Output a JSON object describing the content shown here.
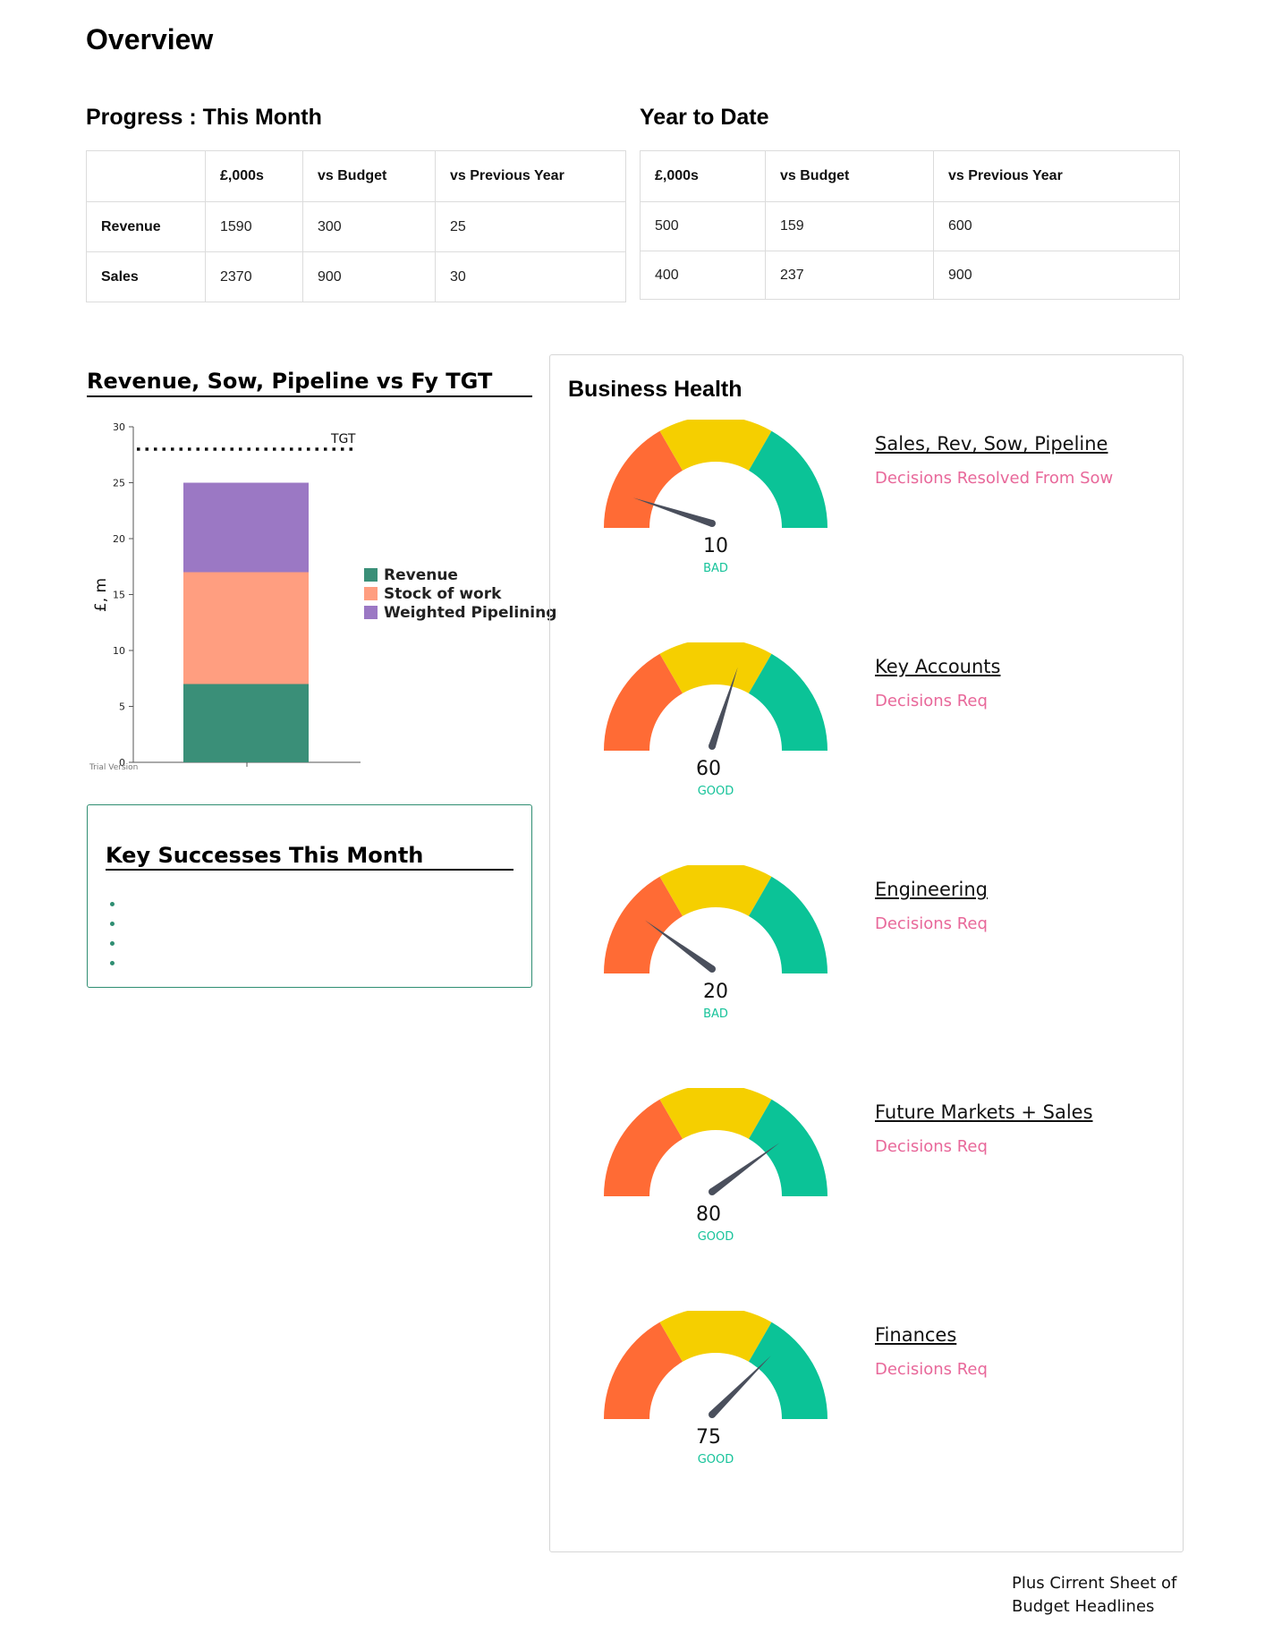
{
  "page": {
    "title": "Overview"
  },
  "progress": {
    "title": "Progress : This Month",
    "headers": [
      "",
      "£,000s",
      "vs Budget",
      "vs Previous Year"
    ],
    "rows": [
      {
        "label": "Revenue",
        "values": [
          "1590",
          "300",
          "25"
        ]
      },
      {
        "label": "Sales",
        "values": [
          "2370",
          "900",
          "30"
        ]
      }
    ]
  },
  "ytd": {
    "title": "Year to Date",
    "headers": [
      "£,000s",
      "vs Budget",
      "vs Previous Year"
    ],
    "rows": [
      {
        "values": [
          "500",
          "159",
          "600"
        ]
      },
      {
        "values": [
          "400",
          "237",
          "900"
        ]
      }
    ]
  },
  "chart_data": {
    "type": "bar",
    "title": "Revenue, Sow, Pipeline vs Fy TGT",
    "xlabel": "",
    "ylabel": "£, m",
    "ylim": [
      0,
      30
    ],
    "yticks": [
      "0",
      "5",
      "10",
      "15",
      "20",
      "25",
      "30"
    ],
    "stacked": true,
    "categories": [
      ""
    ],
    "series": [
      {
        "name": "Revenue",
        "values": [
          7
        ],
        "color": "#3a8f78"
      },
      {
        "name": "Stock of work",
        "values": [
          10
        ],
        "color": "#ff9e80"
      },
      {
        "name": "Weighted Pipelining",
        "values": [
          8
        ],
        "color": "#9b78c4"
      }
    ],
    "target": {
      "label": "TGT",
      "value": 28
    },
    "watermark": "Trial Version",
    "legend_position": "right"
  },
  "successes": {
    "title": "Key Successes This Month",
    "items": [
      "",
      "",
      "",
      ""
    ]
  },
  "health": {
    "title": "Business Health",
    "gauge_colors": {
      "low": "#ff6b35",
      "mid": "#f5cf00",
      "high": "#0bc397",
      "needle": "#4a4f5c"
    },
    "items": [
      {
        "title": "Sales, Rev, Sow, Pipeline",
        "subtitle": "Decisions Resolved From Sow",
        "value": "10",
        "status": "BAD"
      },
      {
        "title": "Key Accounts",
        "subtitle": "Decisions Req",
        "value": "60",
        "status": "GOOD"
      },
      {
        "title": "Engineering",
        "subtitle": "Decisions Req",
        "value": "20",
        "status": "BAD"
      },
      {
        "title": "Future Markets + Sales",
        "subtitle": "Decisions Req",
        "value": "80",
        "status": "GOOD"
      },
      {
        "title": "Finances",
        "subtitle": "Decisions Req",
        "value": "75",
        "status": "GOOD"
      }
    ]
  },
  "footnote": {
    "line1": "Plus Cirrent Sheet of",
    "line2": "Budget Headlines"
  }
}
